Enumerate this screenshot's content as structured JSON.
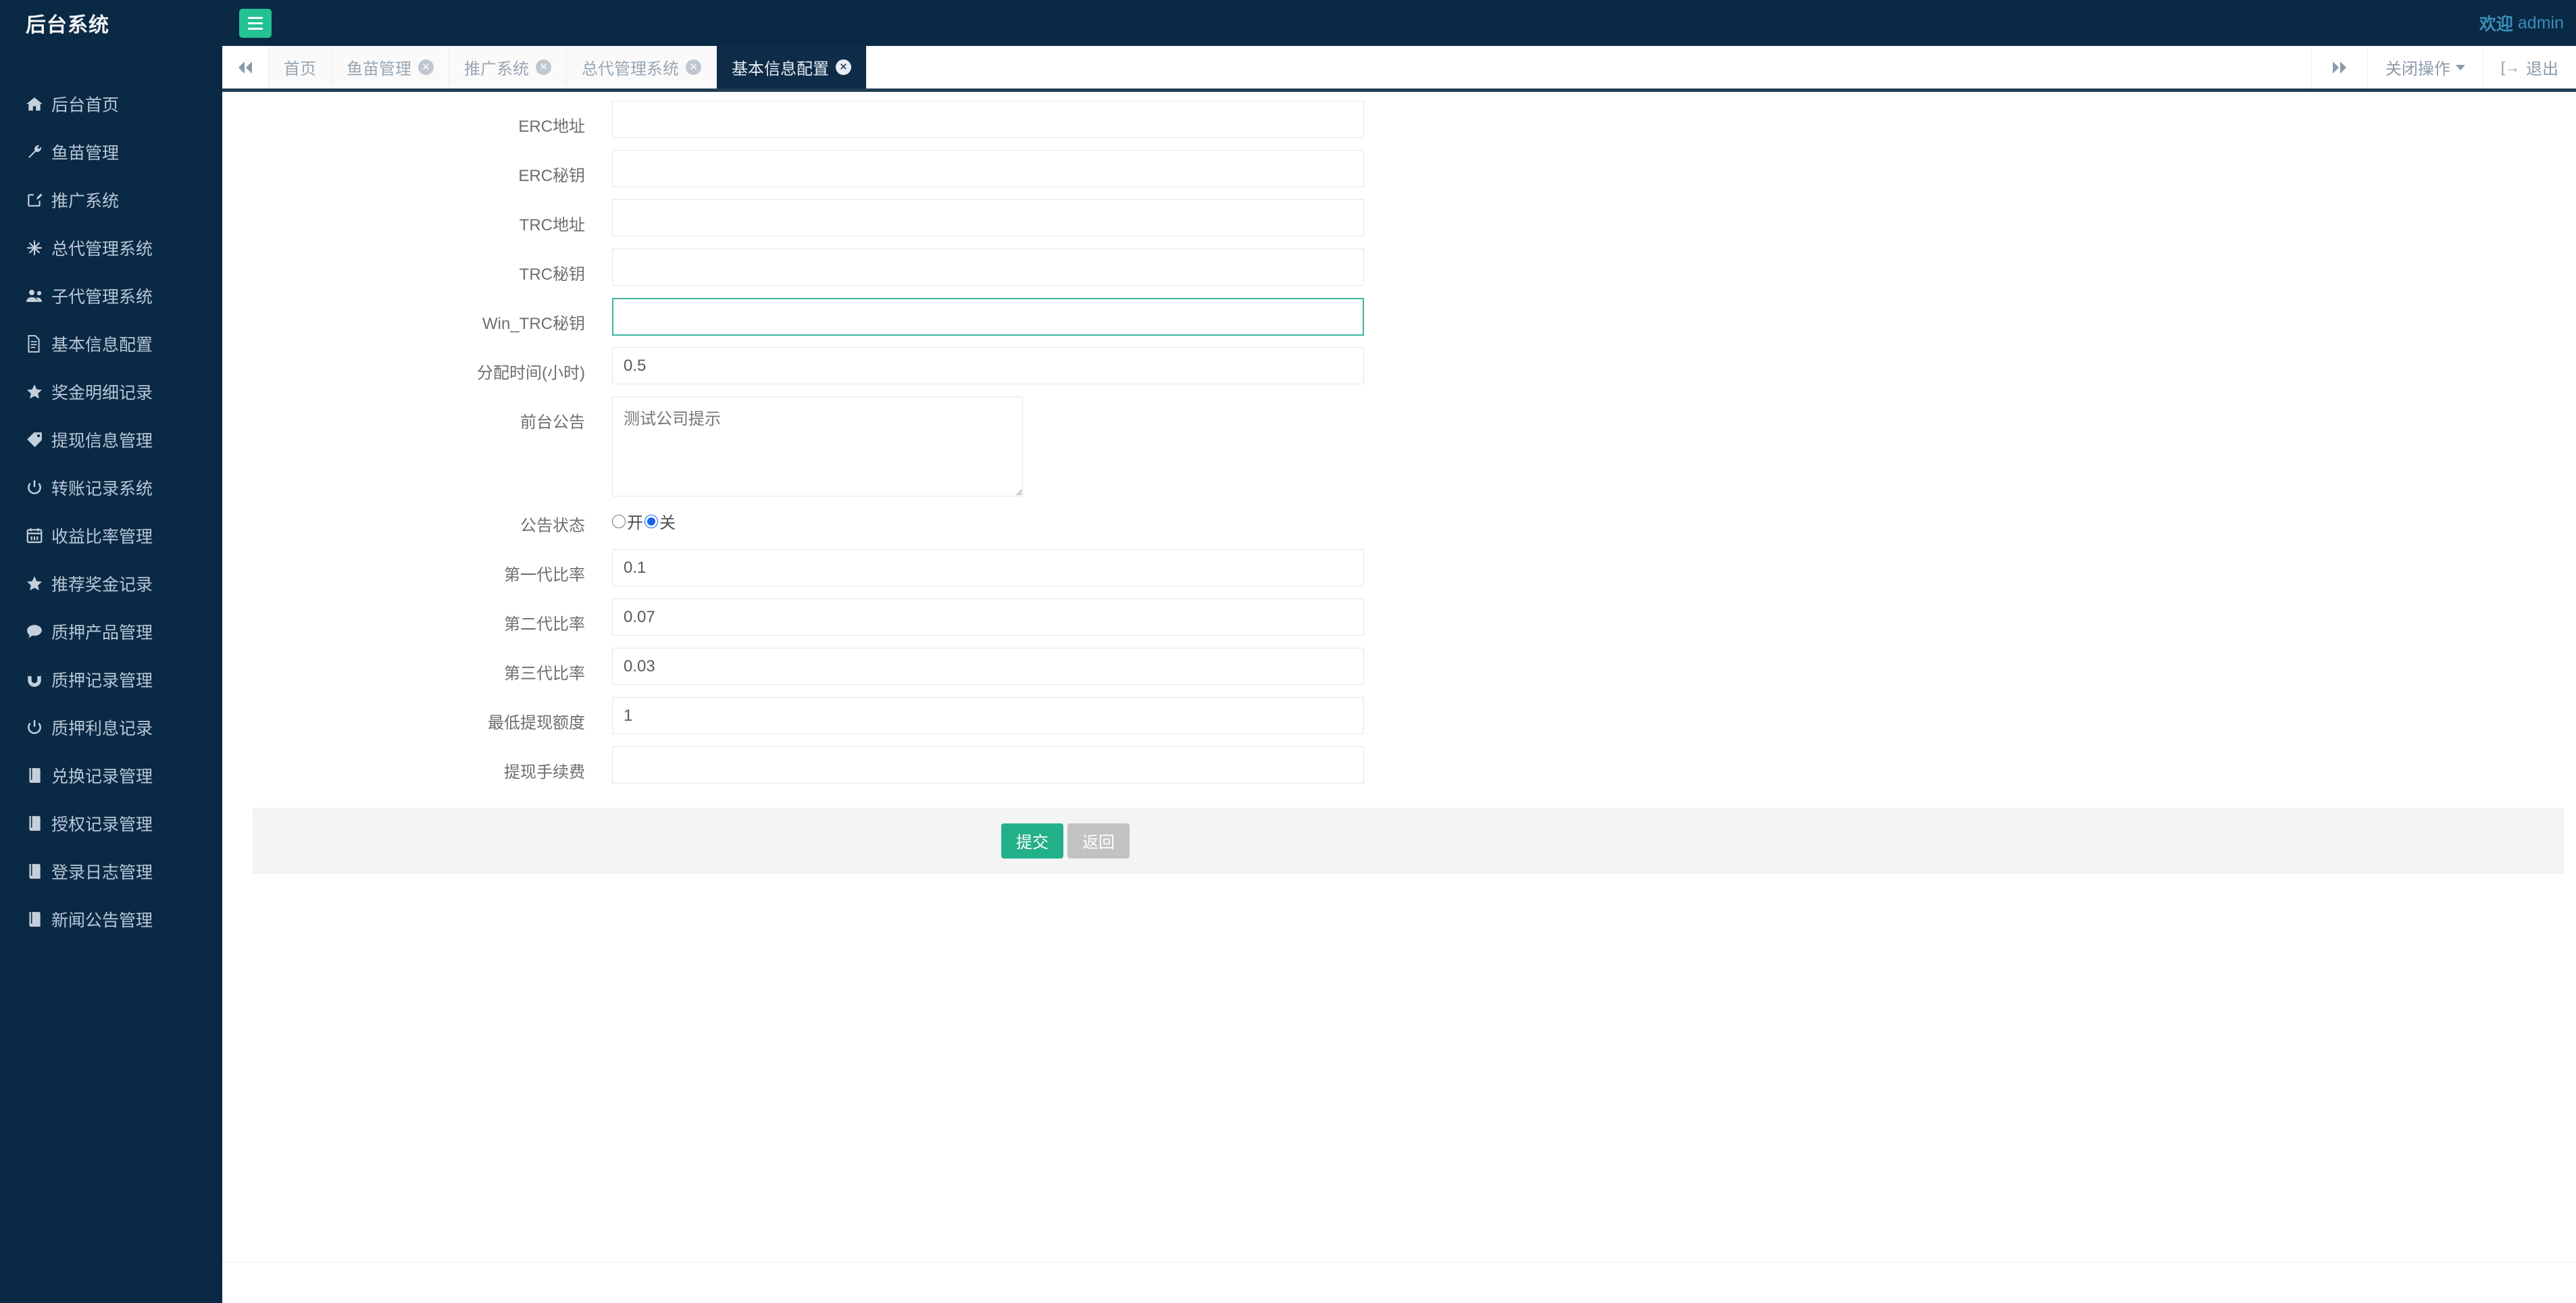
{
  "sidebar": {
    "brand": "后台系统",
    "items": [
      {
        "label": "后台首页",
        "icon": "home-icon"
      },
      {
        "label": "鱼苗管理",
        "icon": "wrench-icon"
      },
      {
        "label": "推广系统",
        "icon": "edit-square-icon"
      },
      {
        "label": "总代管理系统",
        "icon": "asterisk-icon"
      },
      {
        "label": "子代管理系统",
        "icon": "users-icon"
      },
      {
        "label": "基本信息配置",
        "icon": "file-text-icon"
      },
      {
        "label": "奖金明细记录",
        "icon": "star-icon"
      },
      {
        "label": "提现信息管理",
        "icon": "tag-icon"
      },
      {
        "label": "转账记录系统",
        "icon": "power-icon"
      },
      {
        "label": "收益比率管理",
        "icon": "calendar-icon"
      },
      {
        "label": "推荐奖金记录",
        "icon": "star-icon"
      },
      {
        "label": "质押产品管理",
        "icon": "comment-icon"
      },
      {
        "label": "质押记录管理",
        "icon": "magnet-icon"
      },
      {
        "label": "质押利息记录",
        "icon": "power-icon"
      },
      {
        "label": "兑换记录管理",
        "icon": "book-icon"
      },
      {
        "label": "授权记录管理",
        "icon": "book-icon"
      },
      {
        "label": "登录日志管理",
        "icon": "book-icon"
      },
      {
        "label": "新闻公告管理",
        "icon": "book-icon"
      }
    ]
  },
  "header": {
    "menu_toggle_name": "hamburger-icon",
    "welcome_prefix": "欢迎",
    "username": "admin"
  },
  "tabbar": {
    "prev_icon": "double-chevron-left-icon",
    "next_icon": "double-chevron-right-icon",
    "tabs": [
      {
        "label": "首页",
        "closable": false,
        "active": false
      },
      {
        "label": "鱼苗管理",
        "closable": true,
        "active": false
      },
      {
        "label": "推广系统",
        "closable": true,
        "active": false
      },
      {
        "label": "总代管理系统",
        "closable": true,
        "active": false
      },
      {
        "label": "基本信息配置",
        "closable": true,
        "active": true
      }
    ],
    "close_ops_label": "关闭操作",
    "logout_label": "退出",
    "logout_icon": "sign-out-icon"
  },
  "form": {
    "rows": [
      {
        "label": "ERC地址",
        "type": "text",
        "value": "",
        "placeholder": ""
      },
      {
        "label": "ERC秘钥",
        "type": "text",
        "value": "",
        "placeholder": ""
      },
      {
        "label": "TRC地址",
        "type": "text",
        "value": "",
        "placeholder": ""
      },
      {
        "label": "TRC秘钥",
        "type": "text",
        "value": "",
        "placeholder": ""
      },
      {
        "label": "Win_TRC秘钥",
        "type": "text",
        "value": "",
        "placeholder": "",
        "focused": true
      },
      {
        "label": "分配时间(小时)",
        "type": "text",
        "value": "0.5",
        "placeholder": ""
      },
      {
        "label": "前台公告",
        "type": "textarea",
        "value": "",
        "placeholder": "测试公司提示"
      },
      {
        "label": "公告状态",
        "type": "radio",
        "options": [
          {
            "label": "开",
            "checked": false
          },
          {
            "label": "关",
            "checked": true
          }
        ]
      },
      {
        "label": "第一代比率",
        "type": "text",
        "value": "0.1",
        "placeholder": ""
      },
      {
        "label": "第二代比率",
        "type": "text",
        "value": "0.07",
        "placeholder": ""
      },
      {
        "label": "第三代比率",
        "type": "text",
        "value": "0.03",
        "placeholder": ""
      },
      {
        "label": "最低提现额度",
        "type": "text",
        "value": "1",
        "placeholder": ""
      },
      {
        "label": "提现手续费",
        "type": "text",
        "value": "",
        "placeholder": ""
      }
    ],
    "submit_label": "提交",
    "back_label": "返回"
  },
  "colors": {
    "sidebar_bg": "#0a2945",
    "header_bg": "#0a2945",
    "accent_green": "#23c193",
    "submit_green": "#23b189",
    "back_gray": "#c2c2c2",
    "focus_border": "#3bb6a0",
    "welcome_blue": "#3c8dbc",
    "radio_blue": "#1763ed"
  }
}
